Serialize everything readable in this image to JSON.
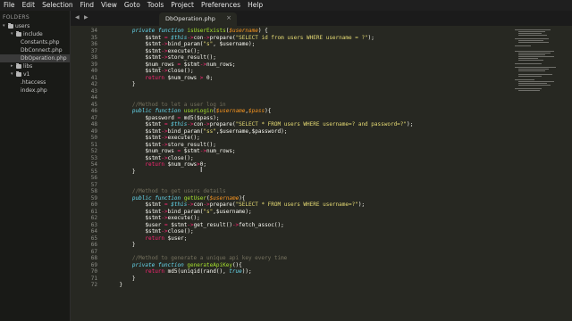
{
  "menu": [
    "File",
    "Edit",
    "Selection",
    "Find",
    "View",
    "Goto",
    "Tools",
    "Project",
    "Preferences",
    "Help"
  ],
  "sidebar": {
    "header": "FOLDERS",
    "tree": [
      {
        "label": "users",
        "depth": 0,
        "expanded": true
      },
      {
        "label": "include",
        "depth": 1,
        "expanded": true
      },
      {
        "label": "Constants.php",
        "depth": 2,
        "file": true
      },
      {
        "label": "DbConnect.php",
        "depth": 2,
        "file": true
      },
      {
        "label": "DbOperation.php",
        "depth": 2,
        "file": true,
        "selected": true
      },
      {
        "label": "libs",
        "depth": 1,
        "expanded": false
      },
      {
        "label": "v1",
        "depth": 1,
        "expanded": true
      },
      {
        "label": ".htaccess",
        "depth": 2,
        "file": true
      },
      {
        "label": "index.php",
        "depth": 2,
        "file": true
      }
    ]
  },
  "tabs": {
    "active": "DbOperation.php",
    "close": "×",
    "left_arrow": "◀",
    "right_arrow": "▶"
  },
  "editor": {
    "lines": [
      {
        "n": "34",
        "t": [
          [
            "        ",
            "tx"
          ],
          [
            "private",
            "kw"
          ],
          [
            " ",
            "tx"
          ],
          [
            "function",
            "kw"
          ],
          [
            " ",
            "tx"
          ],
          [
            "isUserExists",
            "fn"
          ],
          [
            "(",
            "tx"
          ],
          [
            "$username",
            "pm"
          ],
          [
            ") {",
            "tx"
          ]
        ]
      },
      {
        "n": "35",
        "t": [
          [
            "            $stmt ",
            "tx"
          ],
          [
            "=",
            "op"
          ],
          [
            " ",
            "tx"
          ],
          [
            "$this",
            "kw"
          ],
          [
            "->",
            "op"
          ],
          [
            "con",
            "tx"
          ],
          [
            "->",
            "op"
          ],
          [
            "prepare(",
            "tx"
          ],
          [
            "\"SELECT id from users WHERE username = ?\"",
            "st"
          ],
          [
            ");",
            "tx"
          ]
        ]
      },
      {
        "n": "36",
        "t": [
          [
            "            $stmt",
            "tx"
          ],
          [
            "->",
            "op"
          ],
          [
            "bind_param(",
            "tx"
          ],
          [
            "\"s\"",
            "st"
          ],
          [
            ", $username);",
            "tx"
          ]
        ]
      },
      {
        "n": "37",
        "t": [
          [
            "            $stmt",
            "tx"
          ],
          [
            "->",
            "op"
          ],
          [
            "execute();",
            "tx"
          ]
        ]
      },
      {
        "n": "38",
        "t": [
          [
            "            $stmt",
            "tx"
          ],
          [
            "->",
            "op"
          ],
          [
            "store_result();",
            "tx"
          ]
        ]
      },
      {
        "n": "39",
        "t": [
          [
            "            $num_rows ",
            "tx"
          ],
          [
            "=",
            "op"
          ],
          [
            " $stmt",
            "tx"
          ],
          [
            "->",
            "op"
          ],
          [
            "num_rows;",
            "tx"
          ]
        ]
      },
      {
        "n": "40",
        "t": [
          [
            "            $stmt",
            "tx"
          ],
          [
            "->",
            "op"
          ],
          [
            "close();",
            "tx"
          ]
        ]
      },
      {
        "n": "41",
        "t": [
          [
            "            ",
            "tx"
          ],
          [
            "return",
            "ip"
          ],
          [
            " $num_rows ",
            "tx"
          ],
          [
            ">",
            "op"
          ],
          [
            " 0;",
            "tx"
          ]
        ]
      },
      {
        "n": "42",
        "t": [
          [
            "        }",
            "tx"
          ]
        ]
      },
      {
        "n": "43",
        "t": []
      },
      {
        "n": "44",
        "t": []
      },
      {
        "n": "45",
        "t": [
          [
            "        //Method to let a user log in",
            "cm"
          ]
        ]
      },
      {
        "n": "46",
        "t": [
          [
            "        ",
            "tx"
          ],
          [
            "public",
            "kw"
          ],
          [
            " ",
            "tx"
          ],
          [
            "function",
            "kw"
          ],
          [
            " ",
            "tx"
          ],
          [
            "userLogin",
            "fn"
          ],
          [
            "(",
            "tx"
          ],
          [
            "$username",
            "pm"
          ],
          [
            ",",
            "tx"
          ],
          [
            "$pass",
            "pm"
          ],
          [
            "){",
            "tx"
          ]
        ]
      },
      {
        "n": "47",
        "t": [
          [
            "            $password ",
            "tx"
          ],
          [
            "=",
            "op"
          ],
          [
            " md5($pass);",
            "tx"
          ]
        ]
      },
      {
        "n": "48",
        "t": [
          [
            "            $stmt ",
            "tx"
          ],
          [
            "=",
            "op"
          ],
          [
            " ",
            "tx"
          ],
          [
            "$this",
            "kw"
          ],
          [
            "->",
            "op"
          ],
          [
            "con",
            "tx"
          ],
          [
            "->",
            "op"
          ],
          [
            "prepare(",
            "tx"
          ],
          [
            "\"SELECT * FROM users WHERE username=? and password=?\"",
            "st"
          ],
          [
            ");",
            "tx"
          ]
        ]
      },
      {
        "n": "49",
        "t": [
          [
            "            $stmt",
            "tx"
          ],
          [
            "->",
            "op"
          ],
          [
            "bind_param(",
            "tx"
          ],
          [
            "\"ss\"",
            "st"
          ],
          [
            ",$username,$password);",
            "tx"
          ]
        ]
      },
      {
        "n": "50",
        "t": [
          [
            "            $stmt",
            "tx"
          ],
          [
            "->",
            "op"
          ],
          [
            "execute();",
            "tx"
          ]
        ]
      },
      {
        "n": "51",
        "t": [
          [
            "            $stmt",
            "tx"
          ],
          [
            "->",
            "op"
          ],
          [
            "store_result();",
            "tx"
          ]
        ]
      },
      {
        "n": "52",
        "t": [
          [
            "            $num_rows ",
            "tx"
          ],
          [
            "=",
            "op"
          ],
          [
            " $stmt",
            "tx"
          ],
          [
            "->",
            "op"
          ],
          [
            "num_rows;",
            "tx"
          ]
        ]
      },
      {
        "n": "53",
        "t": [
          [
            "            $stmt",
            "tx"
          ],
          [
            "->",
            "op"
          ],
          [
            "close();",
            "tx"
          ]
        ]
      },
      {
        "n": "54",
        "t": [
          [
            "            ",
            "tx"
          ],
          [
            "return",
            "ip"
          ],
          [
            " $num_rows",
            "tx"
          ],
          [
            ">",
            "op"
          ],
          [
            "0;",
            "tx"
          ]
        ]
      },
      {
        "n": "55",
        "t": [
          [
            "        }",
            "tx"
          ]
        ]
      },
      {
        "n": "56",
        "t": []
      },
      {
        "n": "57",
        "t": []
      },
      {
        "n": "58",
        "t": [
          [
            "        //Method to get users details",
            "cm"
          ]
        ]
      },
      {
        "n": "59",
        "t": [
          [
            "        ",
            "tx"
          ],
          [
            "public",
            "kw"
          ],
          [
            " ",
            "tx"
          ],
          [
            "function",
            "kw"
          ],
          [
            " ",
            "tx"
          ],
          [
            "getUser",
            "fn"
          ],
          [
            "(",
            "tx"
          ],
          [
            "$username",
            "pm"
          ],
          [
            "){",
            "tx"
          ]
        ]
      },
      {
        "n": "60",
        "t": [
          [
            "            $stmt ",
            "tx"
          ],
          [
            "=",
            "op"
          ],
          [
            " ",
            "tx"
          ],
          [
            "$this",
            "kw"
          ],
          [
            "->",
            "op"
          ],
          [
            "con",
            "tx"
          ],
          [
            "->",
            "op"
          ],
          [
            "prepare(",
            "tx"
          ],
          [
            "\"SELECT * FROM users WHERE username=?\"",
            "st"
          ],
          [
            ");",
            "tx"
          ]
        ]
      },
      {
        "n": "61",
        "t": [
          [
            "            $stmt",
            "tx"
          ],
          [
            "->",
            "op"
          ],
          [
            "bind_param(",
            "tx"
          ],
          [
            "\"s\"",
            "st"
          ],
          [
            ",$username);",
            "tx"
          ]
        ]
      },
      {
        "n": "62",
        "t": [
          [
            "            $stmt",
            "tx"
          ],
          [
            "->",
            "op"
          ],
          [
            "execute();",
            "tx"
          ]
        ]
      },
      {
        "n": "63",
        "t": [
          [
            "            $user ",
            "tx"
          ],
          [
            "=",
            "op"
          ],
          [
            " $stmt",
            "tx"
          ],
          [
            "->",
            "op"
          ],
          [
            "get_result()",
            "tx"
          ],
          [
            "->",
            "op"
          ],
          [
            "fetch_assoc();",
            "tx"
          ]
        ]
      },
      {
        "n": "64",
        "t": [
          [
            "            $stmt",
            "tx"
          ],
          [
            "->",
            "op"
          ],
          [
            "close();",
            "tx"
          ]
        ]
      },
      {
        "n": "65",
        "t": [
          [
            "            ",
            "tx"
          ],
          [
            "return",
            "ip"
          ],
          [
            " $user;",
            "tx"
          ]
        ]
      },
      {
        "n": "66",
        "t": [
          [
            "        }",
            "tx"
          ]
        ]
      },
      {
        "n": "67",
        "t": []
      },
      {
        "n": "68",
        "t": [
          [
            "        //Method to generate a unique api key every time",
            "cm"
          ]
        ]
      },
      {
        "n": "69",
        "t": [
          [
            "        ",
            "tx"
          ],
          [
            "private",
            "kw"
          ],
          [
            " ",
            "tx"
          ],
          [
            "function",
            "kw"
          ],
          [
            " ",
            "tx"
          ],
          [
            "generateApiKey",
            "fn"
          ],
          [
            "(){",
            "tx"
          ]
        ]
      },
      {
        "n": "70",
        "t": [
          [
            "            ",
            "tx"
          ],
          [
            "return",
            "ip"
          ],
          [
            " md5(uniqid(rand(), ",
            "tx"
          ],
          [
            "true",
            "kw"
          ],
          [
            "));",
            "tx"
          ]
        ]
      },
      {
        "n": "71",
        "t": [
          [
            "        }",
            "tx"
          ]
        ]
      },
      {
        "n": "72",
        "t": [
          [
            "    }",
            "tx"
          ]
        ]
      }
    ]
  },
  "colors": {
    "background": "#272822",
    "keyword": "#66d9ef",
    "function": "#a6e22e",
    "param": "#fd971f",
    "string": "#e6db74",
    "operator": "#f92672",
    "comment": "#75715e"
  }
}
